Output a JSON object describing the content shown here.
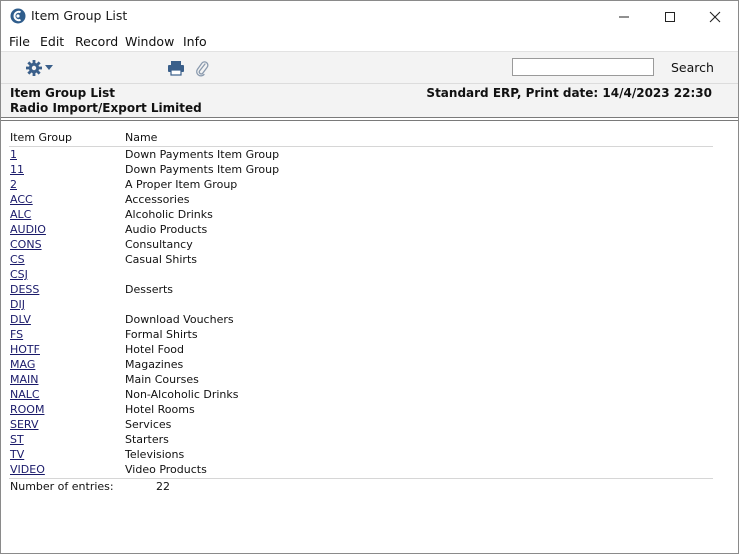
{
  "window": {
    "title": "Item Group List",
    "controls": {
      "minimize": "minimize-icon",
      "maximize": "maximize-icon",
      "close": "close-icon"
    }
  },
  "menu": {
    "items": [
      {
        "label": "File"
      },
      {
        "label": "Edit"
      },
      {
        "label": "Record"
      },
      {
        "label": "Window"
      },
      {
        "label": "Info"
      }
    ]
  },
  "toolbar": {
    "icons": [
      "gear-icon",
      "chevron-down-icon",
      "printer-icon",
      "paperclip-icon"
    ],
    "search_value": "",
    "search_label": "Search"
  },
  "report": {
    "title": "Item Group List",
    "company": "Radio Import/Export Limited",
    "print_info": "Standard ERP, Print date:  14/4/2023 22:30",
    "columns": {
      "code": "Item Group",
      "name": "Name"
    },
    "rows": [
      {
        "code": "1",
        "name": "Down Payments Item Group"
      },
      {
        "code": "11",
        "name": "Down Payments Item Group"
      },
      {
        "code": "2",
        "name": "A Proper Item Group"
      },
      {
        "code": "ACC",
        "name": "Accessories"
      },
      {
        "code": "ALC",
        "name": "Alcoholic Drinks"
      },
      {
        "code": "AUDIO",
        "name": "Audio Products"
      },
      {
        "code": "CONS",
        "name": "Consultancy"
      },
      {
        "code": "CS",
        "name": "Casual Shirts"
      },
      {
        "code": "CSJ",
        "name": ""
      },
      {
        "code": "DESS",
        "name": "Desserts"
      },
      {
        "code": "DIJ",
        "name": ""
      },
      {
        "code": "DLV",
        "name": "Download Vouchers"
      },
      {
        "code": "FS",
        "name": "Formal Shirts"
      },
      {
        "code": "HOTF",
        "name": "Hotel Food"
      },
      {
        "code": "MAG",
        "name": "Magazines"
      },
      {
        "code": "MAIN",
        "name": "Main Courses"
      },
      {
        "code": "NALC",
        "name": "Non-Alcoholic Drinks"
      },
      {
        "code": "ROOM",
        "name": "Hotel Rooms"
      },
      {
        "code": "SERV",
        "name": "Services"
      },
      {
        "code": "ST",
        "name": "Starters"
      },
      {
        "code": "TV",
        "name": "Televisions"
      },
      {
        "code": "VIDEO",
        "name": "Video Products"
      }
    ],
    "footer": {
      "label": "Number of entries:",
      "count": "22"
    }
  },
  "colors": {
    "link": "#1a1a6a",
    "toolbar_bg": "#f3f3f3",
    "icon": "#3a5f8a"
  }
}
